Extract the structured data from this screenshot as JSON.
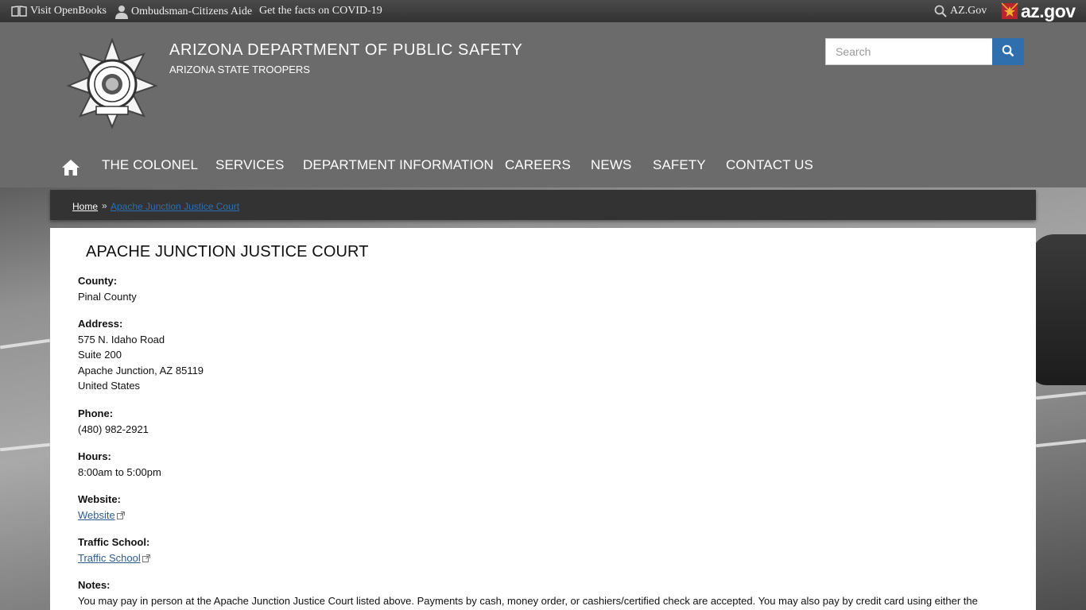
{
  "topbar": {
    "openbooks": "Visit OpenBooks",
    "ombudsman": "Ombudsman-Citizens Aide",
    "covid": "Get the facts on COVID-19",
    "azgov_link": "AZ.Gov",
    "azgov_logo": "az.gov"
  },
  "header": {
    "title": "ARIZONA DEPARTMENT OF PUBLIC SAFETY",
    "subtitle": "ARIZONA STATE TROOPERS",
    "search_placeholder": "Search"
  },
  "nav": {
    "items": [
      "THE COLONEL",
      "SERVICES",
      "DEPARTMENT INFORMATION",
      "CAREERS",
      "NEWS",
      "SAFETY",
      "CONTACT US"
    ]
  },
  "breadcrumb": {
    "home": "Home",
    "separator": "»",
    "current": "Apache Junction Justice Court"
  },
  "court": {
    "title": "APACHE JUNCTION JUSTICE COURT",
    "county_label": "County:",
    "county": "Pinal County",
    "address_label": "Address:",
    "address_lines": [
      "575 N. Idaho Road",
      "Suite 200",
      "Apache Junction, AZ 85119",
      "United States"
    ],
    "phone_label": "Phone:",
    "phone": "(480) 982-2921",
    "hours_label": "Hours:",
    "hours": "8:00am to 5:00pm",
    "website_label": "Website:",
    "website_link": "Website",
    "traffic_label": "Traffic School:",
    "traffic_link": "Traffic School",
    "notes_label": "Notes:",
    "notes": "You may pay in person at the Apache Junction Justice Court listed above. Payments by cash, money order, or cashiers/certified check are accepted. You may also pay by credit card using either the"
  },
  "colors": {
    "header_bg": "#6b6b6b",
    "topbar_bg": "#3a3a3a",
    "breadcrumb_bg": "#333333",
    "search_button": "#2f6fae",
    "link": "#2c5c8f"
  },
  "icons": {
    "openbooks": "book-icon",
    "ombudsman": "person-icon",
    "azgov": "magnifier-icon",
    "search": "search-icon",
    "home": "home-icon",
    "external": "external-link-icon"
  }
}
